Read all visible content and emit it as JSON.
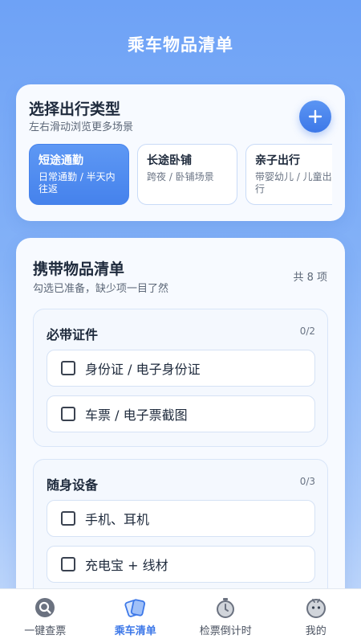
{
  "header": {
    "title": "乘车物品清单"
  },
  "trip_type": {
    "title": "选择出行类型",
    "subtitle": "左右滑动浏览更多场景",
    "scenes": [
      {
        "title": "短途通勤",
        "desc": "日常通勤 / 半天内往返",
        "selected": true
      },
      {
        "title": "长途卧铺",
        "desc": "跨夜 / 卧铺场景",
        "selected": false
      },
      {
        "title": "亲子出行",
        "desc": "带婴幼儿 / 儿童出行",
        "selected": false
      }
    ]
  },
  "checklist": {
    "title": "携带物品清单",
    "subtitle": "勾选已准备，缺少项一目了然",
    "count": "共 8 项",
    "sections": [
      {
        "title": "必带证件",
        "count": "0/2",
        "items": [
          "身份证 / 电子身份证",
          "车票 / 电子票截图"
        ]
      },
      {
        "title": "随身设备",
        "count": "0/3",
        "items": [
          "手机、耳机",
          "充电宝 + 线材"
        ]
      }
    ]
  },
  "tabs": [
    {
      "label": "一键查票",
      "icon": "search-icon"
    },
    {
      "label": "乘车清单",
      "icon": "tickets-icon",
      "active": true
    },
    {
      "label": "检票倒计时",
      "icon": "timer-icon"
    },
    {
      "label": "我的",
      "icon": "profile-face-icon"
    }
  ],
  "colors": {
    "accent": "#3d78e8",
    "background_top": "#6ea2f6"
  }
}
